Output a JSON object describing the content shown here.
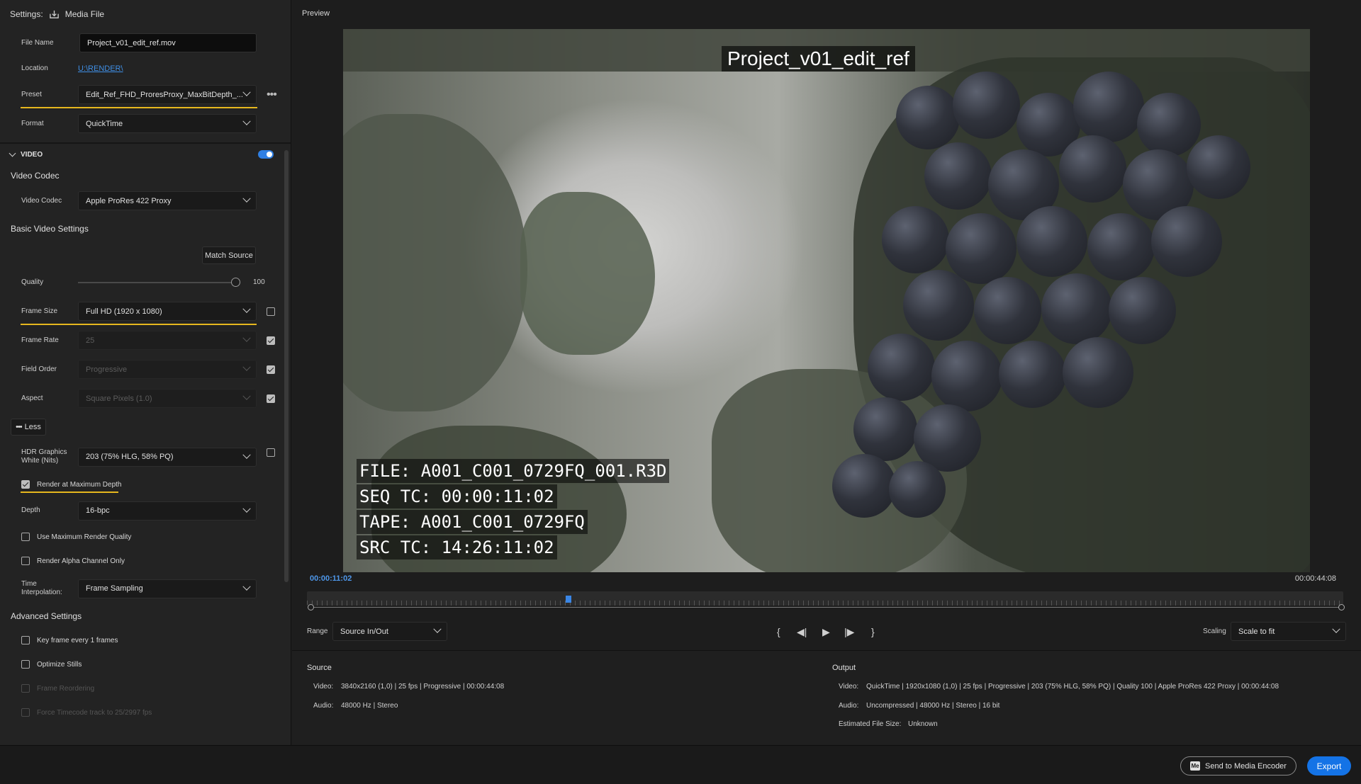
{
  "header": {
    "settings_label": "Settings:",
    "media_file_label": "Media File"
  },
  "output": {
    "file_name_label": "File Name",
    "file_name": "Project_v01_edit_ref.mov",
    "location_label": "Location",
    "location": "U:\\RENDER\\",
    "preset_label": "Preset",
    "preset": "Edit_Ref_FHD_ProresProxy_MaxBitDepth_...",
    "format_label": "Format",
    "format": "QuickTime"
  },
  "video": {
    "section_label": "VIDEO",
    "codec_heading": "Video Codec",
    "codec_label": "Video Codec",
    "codec": "Apple ProRes 422 Proxy",
    "basic_heading": "Basic Video Settings",
    "match_source": "Match Source",
    "quality_label": "Quality",
    "quality_value": "100",
    "quality": 100,
    "frame_size_label": "Frame Size",
    "frame_size": "Full HD (1920 x 1080)",
    "frame_rate_label": "Frame Rate",
    "frame_rate": "25",
    "field_order_label": "Field Order",
    "field_order": "Progressive",
    "aspect_label": "Aspect",
    "aspect": "Square Pixels (1.0)",
    "less_label": "Less",
    "hdr_label": "HDR Graphics White (Nits)",
    "hdr": "203 (75% HLG, 58% PQ)",
    "render_max_depth": "Render at Maximum Depth",
    "depth_label": "Depth",
    "depth": "16-bpc",
    "max_render_quality": "Use Maximum Render Quality",
    "alpha_only": "Render Alpha Channel Only",
    "time_interp_label": "Time Interpolation:",
    "time_interp": "Frame Sampling",
    "advanced_heading": "Advanced Settings",
    "keyframe": "Key frame every 1 frames",
    "optimize_stills": "Optimize Stills",
    "frame_reordering": "Frame Reordering",
    "force_timecode": "Force Timecode track to 25/2997 fps"
  },
  "preview": {
    "label": "Preview",
    "title_overlay": "Project_v01_edit_ref",
    "burnin": [
      "FILE: A001_C001_0729FQ_001.R3D",
      "SEQ TC: 00:00:11:02",
      "TAPE: A001_C001_0729FQ",
      "SRC TC: 14:26:11:02"
    ],
    "current_tc": "00:00:11:02",
    "duration_tc": "00:00:44:08",
    "playhead_fraction": 0.25,
    "range_label": "Range",
    "range": "Source In/Out",
    "scaling_label": "Scaling",
    "scaling": "Scale to fit"
  },
  "source": {
    "heading": "Source",
    "video_label": "Video:",
    "video": "3840x2160 (1,0)  |  25 fps  |  Progressive  |  00:00:44:08",
    "audio_label": "Audio:",
    "audio": "48000 Hz  |  Stereo"
  },
  "output_info": {
    "heading": "Output",
    "video_label": "Video:",
    "video": "QuickTime  |  1920x1080 (1,0)  |  25 fps  |  Progressive  |  203 (75% HLG, 58% PQ)  |  Quality 100  |  Apple ProRes 422 Proxy  |  00:00:44:08",
    "audio_label": "Audio:",
    "audio": "Uncompressed  |  48000 Hz  |  Stereo  |  16 bit",
    "size_label": "Estimated File Size:",
    "size": "Unknown"
  },
  "footer": {
    "send_label": "Send to Media Encoder",
    "send_icon": "Me",
    "export_label": "Export"
  },
  "colors": {
    "accent": "#1473e6",
    "highlight": "#e6b71e",
    "timecode": "#4e97ea"
  }
}
